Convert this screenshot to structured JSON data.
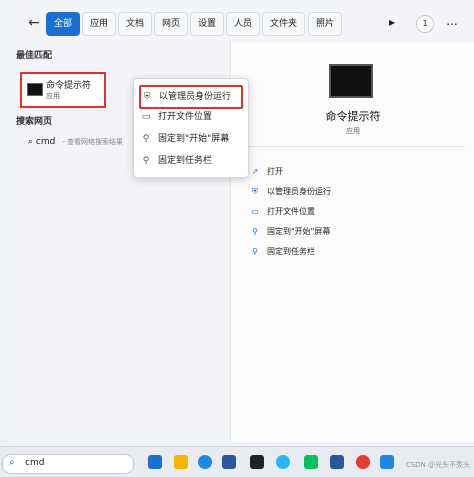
{
  "tabs": {
    "items": [
      "全部",
      "应用",
      "文档",
      "网页",
      "设置",
      "人员",
      "文件夹",
      "照片"
    ],
    "count_badge": "1",
    "more": "..."
  },
  "left": {
    "best_match_title": "最佳匹配",
    "best_match": {
      "name": "命令提示符",
      "type": "应用"
    },
    "web_title": "搜索网页",
    "web_item": {
      "query": "cmd",
      "hint": "- 查看网络搜索结果"
    }
  },
  "context_menu": {
    "items": [
      {
        "icon": "admin-shield-icon",
        "label": "以管理员身份运行"
      },
      {
        "icon": "folder-icon",
        "label": "打开文件位置"
      },
      {
        "icon": "pin-icon",
        "label": "固定到\"开始\"屏幕"
      },
      {
        "icon": "pin-icon",
        "label": "固定到任务栏"
      }
    ]
  },
  "right_panel": {
    "title": "命令提示符",
    "subtitle": "应用",
    "actions": [
      {
        "icon": "open-icon",
        "label": "打开"
      },
      {
        "icon": "admin-shield-icon",
        "label": "以管理员身份运行"
      },
      {
        "icon": "folder-icon",
        "label": "打开文件位置"
      },
      {
        "icon": "pin-icon",
        "label": "固定到\"开始\"屏幕"
      },
      {
        "icon": "pin-icon",
        "label": "固定到任务栏"
      }
    ]
  },
  "taskbar": {
    "search_value": "cmd",
    "icons": [
      "windows-icon",
      "widgets-icon",
      "file-explorer-icon",
      "edge-icon",
      "store-icon",
      "terminal-icon",
      "browser-icon",
      "wechat-icon",
      "word-icon",
      "netease-icon",
      "app-icon"
    ]
  },
  "watermark": "CSDN @光头不秃头"
}
